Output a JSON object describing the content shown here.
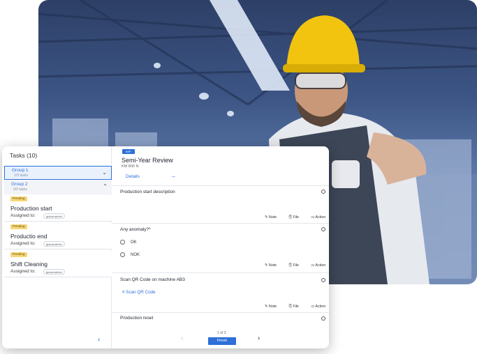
{
  "sidebar": {
    "title": "Tasks (10)",
    "groups": [
      {
        "name": "Group 1",
        "sub": "1/3 tasks"
      },
      {
        "name": "Group 2",
        "sub": "0/3 tasks"
      }
    ],
    "tasks": [
      {
        "status": "Pending",
        "name": "Production start",
        "assigned_label": "Assigned to:",
        "assignee": "global.admin"
      },
      {
        "status": "Pending",
        "name": "Productio end",
        "assigned_label": "Assigned to:",
        "assignee": "global.admin"
      },
      {
        "status": "Pending",
        "name": "Shift Cleaning",
        "assigned_label": "Assigned to:",
        "assignee": "global.admin"
      }
    ]
  },
  "main": {
    "badge": "WIP",
    "title": "Semi-Year Review",
    "subtitle": "KM 800 N",
    "details_label": "Details",
    "questions": [
      {
        "label": "Production start description"
      },
      {
        "label": "Any anomaly?*",
        "options": [
          "OK",
          "NOK"
        ]
      },
      {
        "label": "Scan QR Code on machine AB3",
        "scan_label": "Scan QR Code"
      },
      {
        "label": "Production reset"
      }
    ],
    "actions": {
      "note": "Note",
      "file": "File",
      "action": "Action"
    },
    "pager": {
      "text": "1 of 3",
      "finish": "Finish"
    }
  }
}
